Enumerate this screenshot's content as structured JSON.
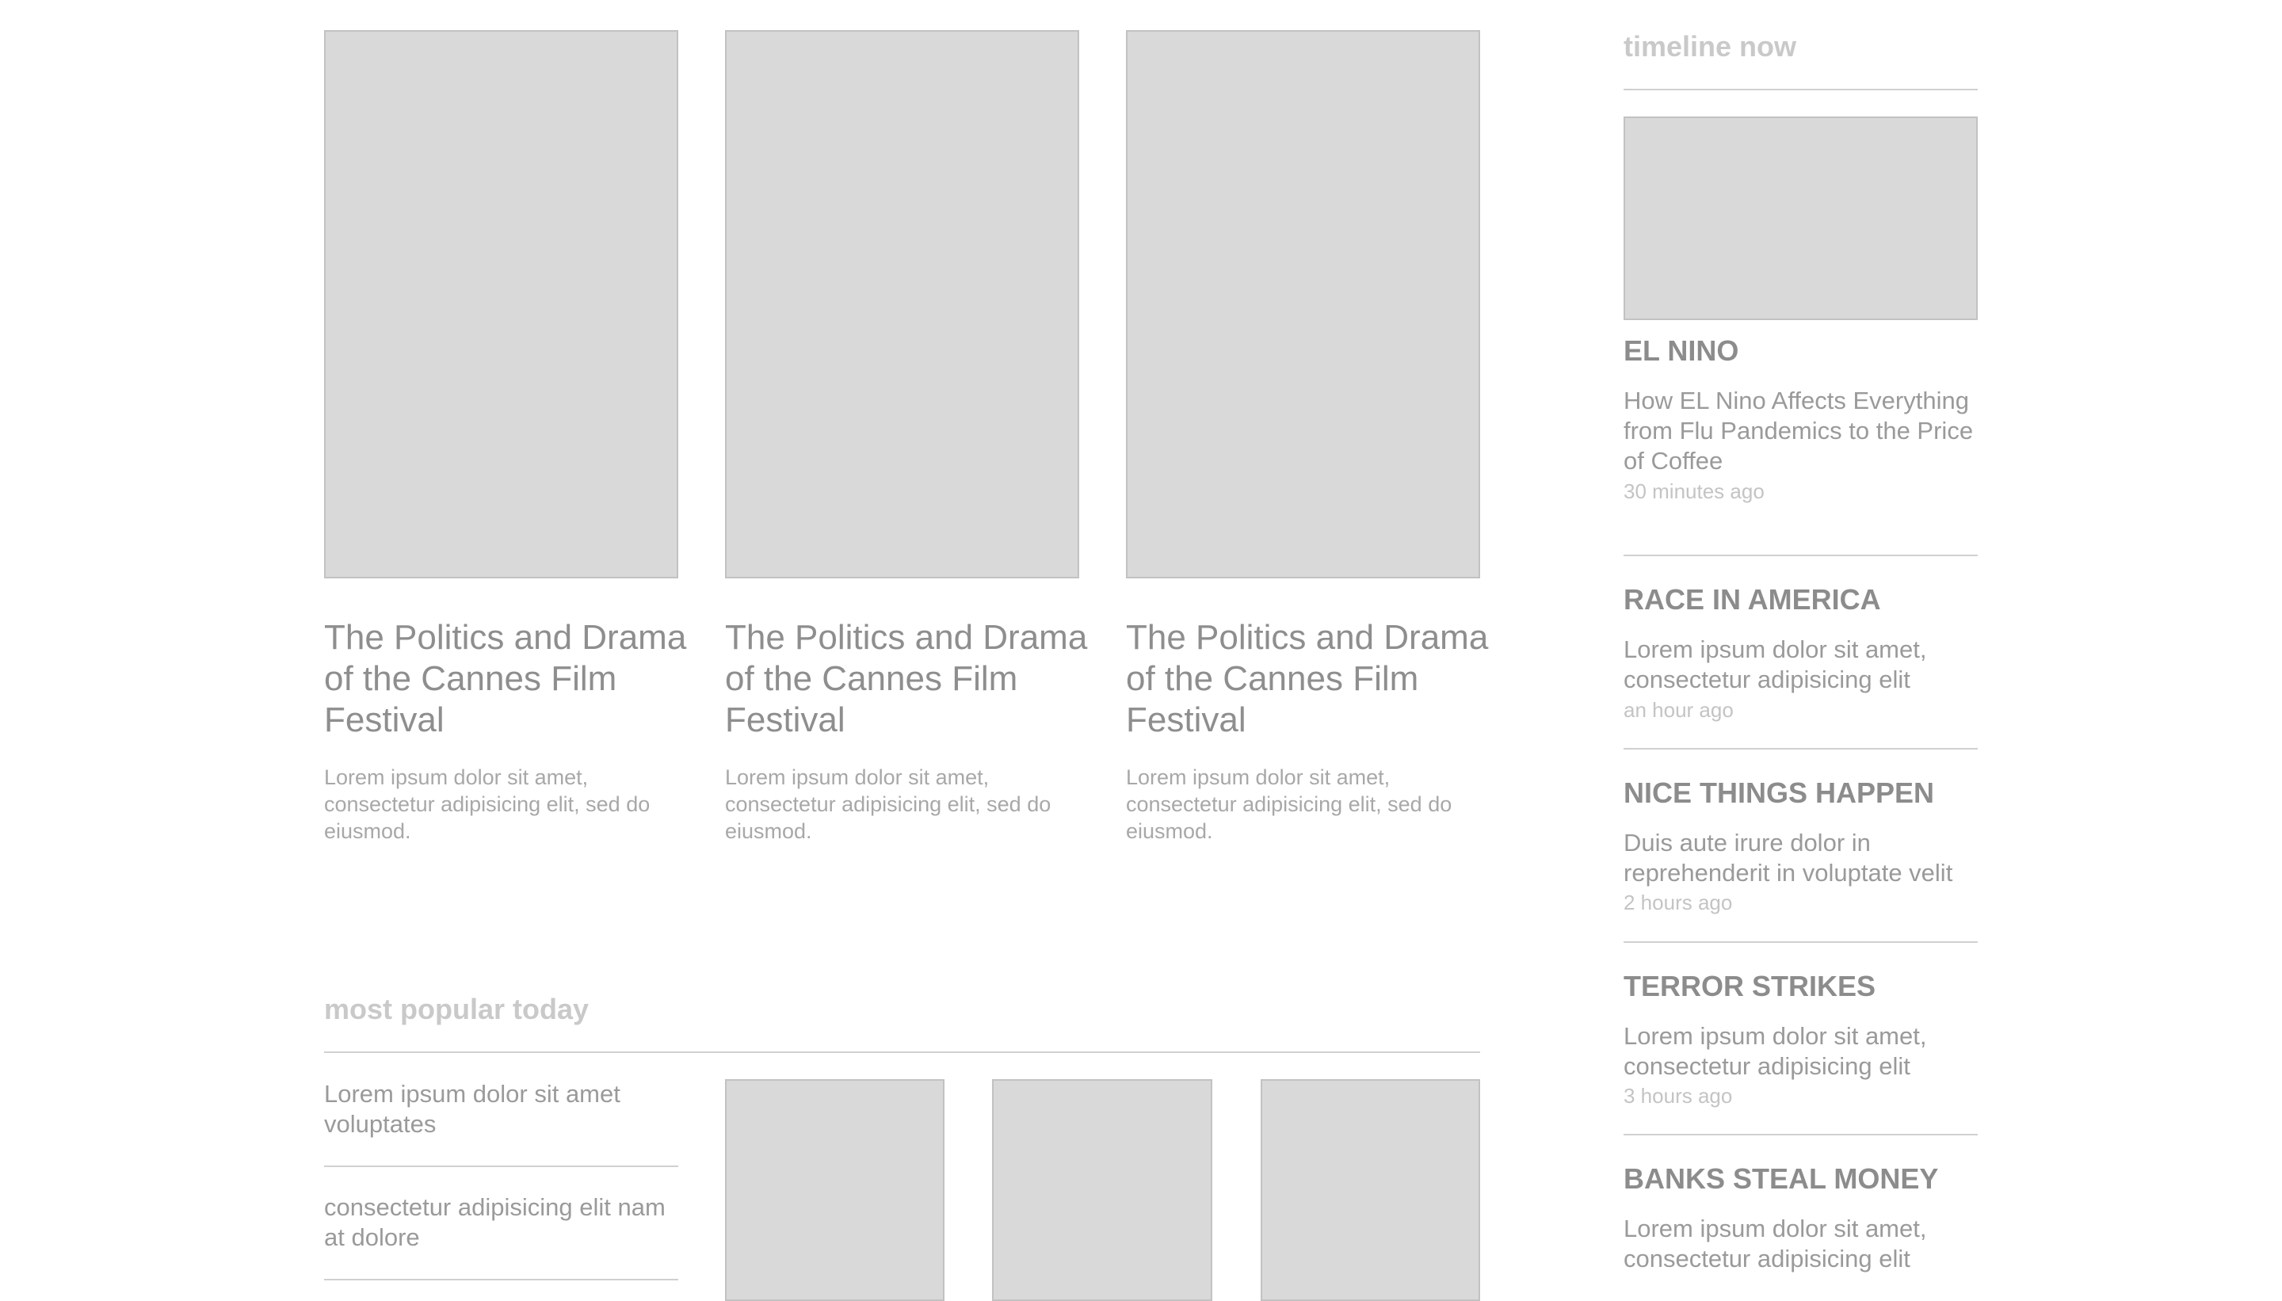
{
  "featured": [
    {
      "title": "The Politics and Drama of the Cannes Film Festival",
      "excerpt": "Lorem ipsum dolor sit amet, consectetur adipisicing elit, sed do eiusmod."
    },
    {
      "title": "The Politics and Drama of the Cannes Film Festival",
      "excerpt": "Lorem ipsum dolor sit amet, consectetur adipisicing elit, sed do eiusmod."
    },
    {
      "title": "The Politics and Drama of the Cannes Film Festival",
      "excerpt": "Lorem ipsum dolor sit amet, consectetur adipisicing elit, sed do eiusmod."
    }
  ],
  "most_popular": {
    "heading": "most popular today",
    "items": [
      "Lorem ipsum dolor sit amet voluptates",
      "consectetur adipisicing elit nam at dolore"
    ]
  },
  "timeline": {
    "heading": "timeline now",
    "items": [
      {
        "category": "EL NINO",
        "headline": "How EL Nino Affects Everything from Flu Pandemics to the Price of Coffee",
        "time": "30 minutes ago"
      },
      {
        "category": "RACE IN AMERICA",
        "headline": "Lorem ipsum dolor sit amet, consectetur adipisicing elit",
        "time": "an hour ago"
      },
      {
        "category": "NICE THINGS HAPPEN",
        "headline": "Duis aute irure dolor in reprehenderit in voluptate velit",
        "time": "2 hours ago"
      },
      {
        "category": "TERROR STRIKES",
        "headline": "Lorem ipsum dolor sit amet, consectetur adipisicing elit",
        "time": "3 hours ago"
      },
      {
        "category": "BANKS STEAL MONEY",
        "headline": "Lorem ipsum dolor sit amet, consectetur adipisicing elit"
      }
    ]
  }
}
